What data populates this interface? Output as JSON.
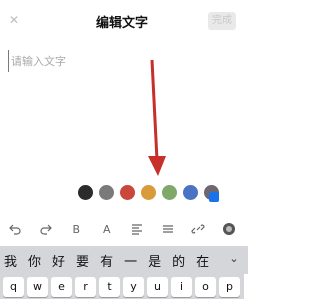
{
  "header": {
    "close_icon": "close-icon",
    "title": "编辑文字",
    "done_label": "完成"
  },
  "editor": {
    "placeholder": "请输入文字"
  },
  "palette": {
    "colors": [
      "#2b2b2b",
      "#7a7a7a",
      "#c9483b",
      "#d99a3a",
      "#7fa86a",
      "#4a73c4",
      "#6e6670"
    ]
  },
  "toolbar": {
    "tools": [
      "undo-icon",
      "redo-icon",
      "bold-icon",
      "font-icon",
      "align-icon",
      "strike-icon",
      "link-icon",
      "color-icon"
    ],
    "bold_glyph": "B",
    "font_glyph": "A"
  },
  "keyboard": {
    "candidates": [
      "我",
      "你",
      "好",
      "要",
      "有",
      "一",
      "是",
      "的",
      "在"
    ],
    "keys": [
      "q",
      "w",
      "e",
      "r",
      "t",
      "y",
      "u",
      "i",
      "o",
      "p"
    ],
    "expand_icon": "chevron-down-icon"
  }
}
